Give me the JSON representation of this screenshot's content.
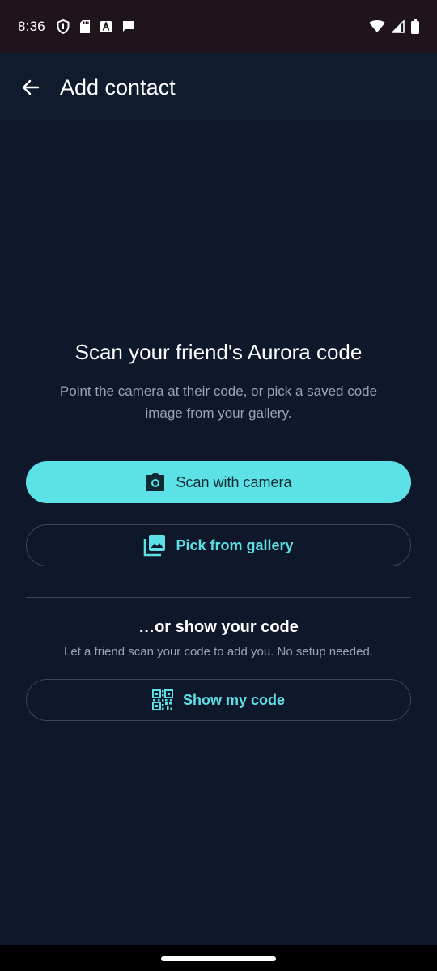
{
  "status_bar": {
    "time": "8:36",
    "icons_left": [
      "shield-icon",
      "sd-card-icon",
      "font-a-icon",
      "message-icon"
    ],
    "icons_right": [
      "wifi-icon",
      "cell-signal-icon",
      "battery-icon"
    ]
  },
  "app_bar": {
    "title": "Add contact",
    "back_icon": "arrow-back-icon"
  },
  "main": {
    "scan_title": "Scan your friend's Aurora code",
    "scan_subtitle": "Point the camera at their code, or pick a saved code image from your gallery.",
    "scan_button_label": "Scan with camera",
    "gallery_button_label": "Pick from gallery",
    "show_title": "…or show your code",
    "show_subtitle": "Let a friend scan your code to add you. No setup needed.",
    "show_code_button_label": "Show my code"
  },
  "colors": {
    "background": "#0f172a",
    "status_bar": "#1f141c",
    "app_bar": "#111b2e",
    "accent": "#5ce1e6",
    "muted_text": "#9aa3b5",
    "outline": "#3a4558"
  }
}
